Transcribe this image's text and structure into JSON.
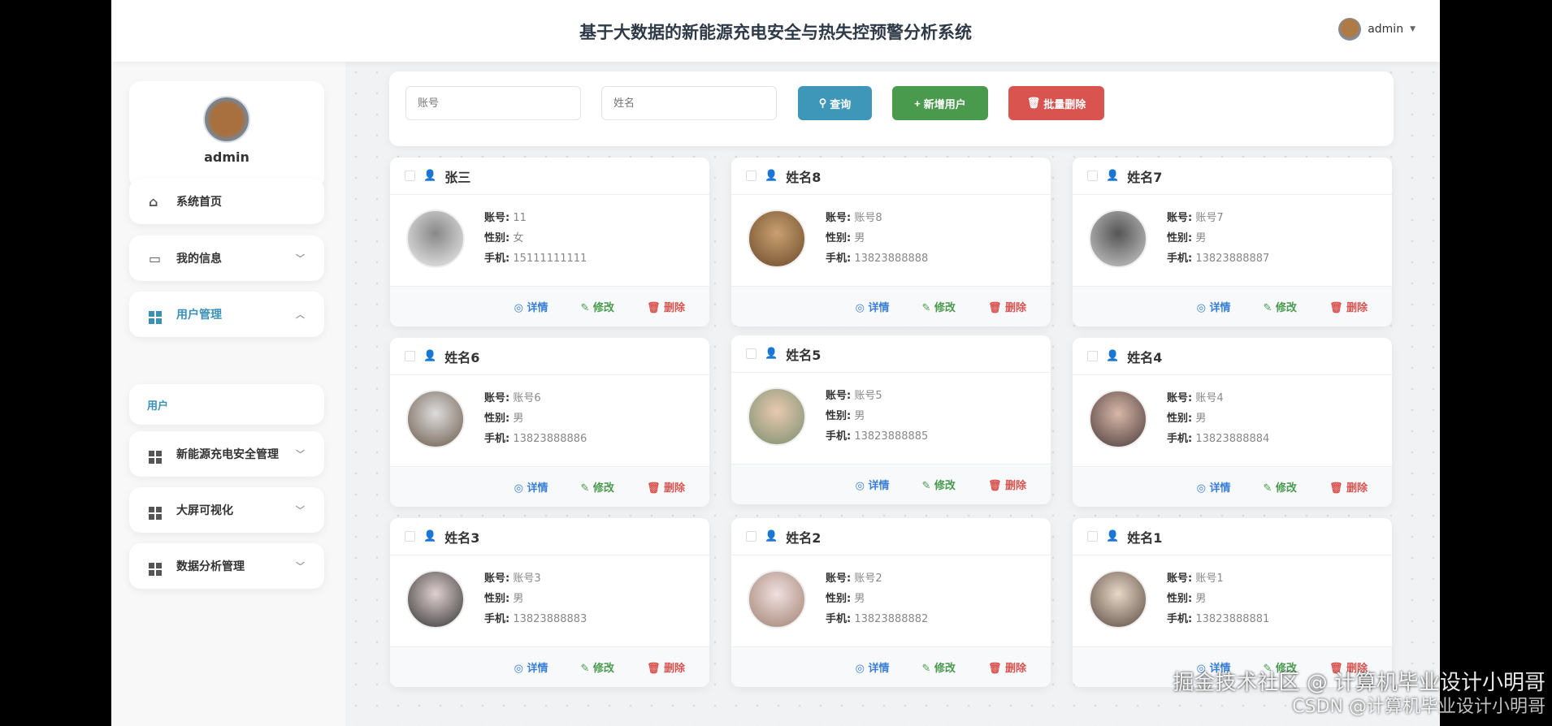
{
  "header": {
    "title": "基于大数据的新能源充电安全与热失控预警分析系统",
    "user": "admin"
  },
  "sidebar": {
    "profile_name": "admin",
    "items": [
      {
        "label": "系统首页",
        "icon": "home-icon"
      },
      {
        "label": "我的信息",
        "icon": "card-icon"
      },
      {
        "label": "用户管理",
        "icon": "grid-icon"
      },
      {
        "label": "用户",
        "icon": ""
      },
      {
        "label": "新能源充电安全管理",
        "icon": "grid-icon"
      },
      {
        "label": "大屏可视化",
        "icon": "grid-icon"
      },
      {
        "label": "数据分析管理",
        "icon": "grid-icon"
      }
    ]
  },
  "search": {
    "account_placeholder": "账号",
    "name_placeholder": "姓名",
    "query": "查询",
    "add": "新增用户",
    "batch_delete": "批量删除"
  },
  "labels": {
    "account": "账号:",
    "gender": "性别:",
    "phone": "手机:",
    "detail": "详情",
    "edit": "修改",
    "delete": "删除"
  },
  "cards": [
    {
      "name": "张三",
      "account": "11",
      "gender": "女",
      "phone": "15111111111"
    },
    {
      "name": "姓名8",
      "account": "账号8",
      "gender": "男",
      "phone": "13823888888"
    },
    {
      "name": "姓名7",
      "account": "账号7",
      "gender": "男",
      "phone": "13823888887"
    },
    {
      "name": "姓名6",
      "account": "账号6",
      "gender": "男",
      "phone": "13823888886"
    },
    {
      "name": "姓名5",
      "account": "账号5",
      "gender": "男",
      "phone": "13823888885"
    },
    {
      "name": "姓名4",
      "account": "账号4",
      "gender": "男",
      "phone": "13823888884"
    },
    {
      "name": "姓名3",
      "account": "账号3",
      "gender": "男",
      "phone": "13823888883"
    },
    {
      "name": "姓名2",
      "account": "账号2",
      "gender": "男",
      "phone": "13823888882"
    },
    {
      "name": "姓名1",
      "account": "账号1",
      "gender": "男",
      "phone": "13823888881"
    }
  ],
  "watermark": {
    "line1": "掘金技术社区 @ 计算机毕业设计小明哥",
    "line2": "CSDN @计算机毕业设计小明哥"
  },
  "colors": {
    "primary": "#3a91b4",
    "query": "#3e97b8",
    "add": "#4a9a4e",
    "delete": "#d9534f"
  }
}
